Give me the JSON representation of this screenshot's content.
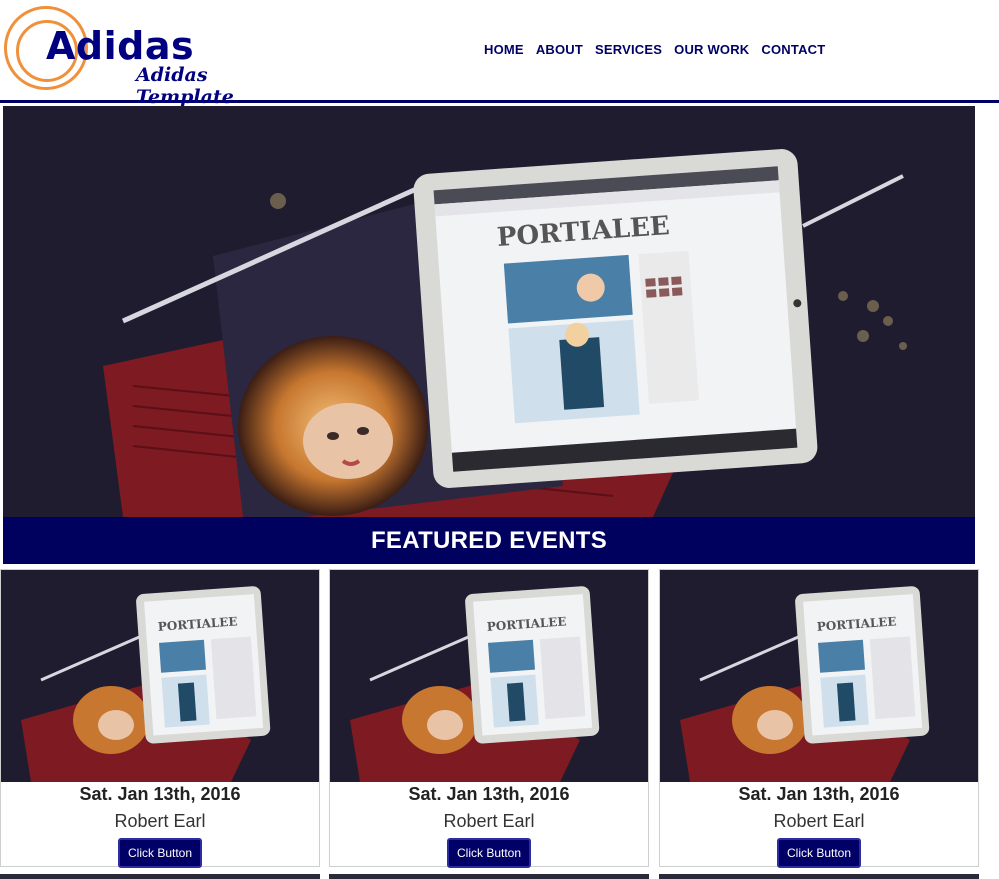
{
  "brand": {
    "title": "Adidas",
    "subtitle": "Adidas Template"
  },
  "nav": [
    "HOME",
    "ABOUT",
    "SERVICES",
    "OUR WORK",
    "CONTACT"
  ],
  "featured": {
    "title": "FEATURED EVENTS"
  },
  "tablet_screen_text": "PORTIALEE",
  "cards": [
    {
      "date": "Sat. Jan 13th, 2016",
      "name": "Robert Earl",
      "button": "Click Button"
    },
    {
      "date": "Sat. Jan 13th, 2016",
      "name": "Robert Earl",
      "button": "Click Button"
    },
    {
      "date": "Sat. Jan 13th, 2016",
      "name": "Robert Earl",
      "button": "Click Button"
    }
  ],
  "colors": {
    "navy": "#000066",
    "orange": "#f0903a",
    "dark_photo": "#1c1a2c"
  }
}
